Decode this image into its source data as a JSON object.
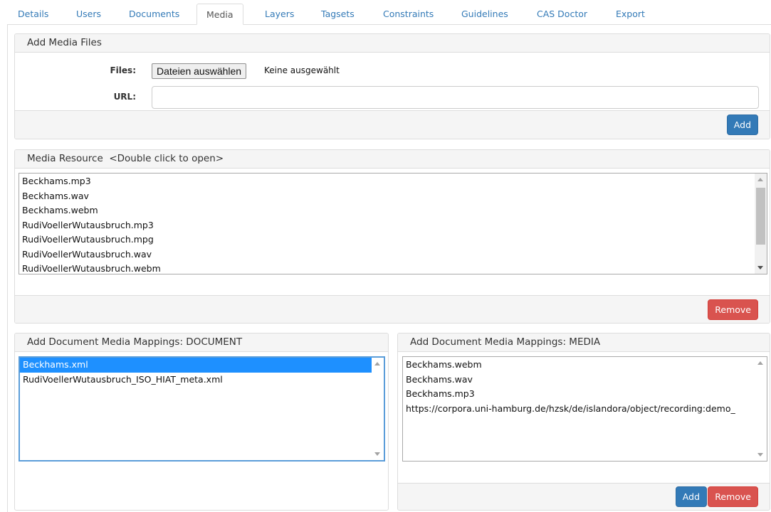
{
  "tabs": [
    {
      "label": "Details"
    },
    {
      "label": "Users"
    },
    {
      "label": "Documents"
    },
    {
      "label": "Media"
    },
    {
      "label": "Layers"
    },
    {
      "label": "Tagsets"
    },
    {
      "label": "Constraints"
    },
    {
      "label": "Guidelines"
    },
    {
      "label": "CAS Doctor"
    },
    {
      "label": "Export"
    }
  ],
  "active_tab": "Media",
  "add_media": {
    "title": "Add Media Files",
    "files_label": "Files:",
    "file_button": "Dateien auswählen",
    "file_status": "Keine ausgewählt",
    "url_label": "URL:",
    "url_value": "",
    "add_button": "Add"
  },
  "media_resource": {
    "title": "Media Resource  <Double click to open>",
    "items": [
      "Beckhams.mp3",
      "Beckhams.wav",
      "Beckhams.webm",
      "RudiVoellerWutausbruch.mp3",
      "RudiVoellerWutausbruch.mpg",
      "RudiVoellerWutausbruch.wav",
      "RudiVoellerWutausbruch.webm"
    ],
    "remove_button": "Remove"
  },
  "mapping_document": {
    "title": "Add Document Media Mappings: DOCUMENT",
    "items": [
      "Beckhams.xml",
      "RudiVoellerWutausbruch_ISO_HIAT_meta.xml"
    ],
    "selected_index": 0
  },
  "mapping_media": {
    "title": "Add Document Media Mappings: MEDIA",
    "items": [
      "Beckhams.webm",
      "Beckhams.wav",
      "Beckhams.mp3",
      "https://corpora.uni-hamburg.de/hzsk/de/islandora/object/recording:demo_"
    ],
    "add_button": "Add",
    "remove_button": "Remove"
  },
  "colors": {
    "link": "#337ab7",
    "primary": "#337ab7",
    "danger": "#d9534f",
    "selection": "#1e90ff",
    "panel_heading": "#f5f5f5",
    "border": "#dddddd"
  }
}
